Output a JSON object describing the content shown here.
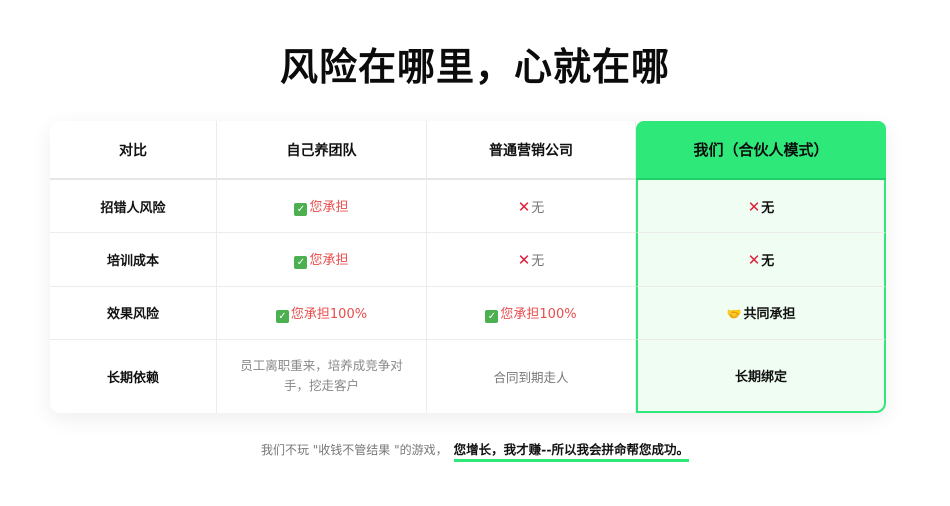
{
  "title": "风险在哪里，心就在哪",
  "table": {
    "headers": [
      "对比",
      "自己养团队",
      "普通营销公司",
      "我们（合伙人模式）"
    ],
    "rows": [
      {
        "label": "招错人风险",
        "self": {
          "icon": "check-icon",
          "text": "您承担"
        },
        "agency": {
          "icon": "cross-icon",
          "text": "无"
        },
        "ours": {
          "icon": "cross-icon",
          "text": "无"
        }
      },
      {
        "label": "培训成本",
        "self": {
          "icon": "check-icon",
          "text": "您承担"
        },
        "agency": {
          "icon": "cross-icon",
          "text": "无"
        },
        "ours": {
          "icon": "cross-icon",
          "text": "无"
        }
      },
      {
        "label": "效果风险",
        "self": {
          "icon": "check-icon",
          "text": "您承担100%"
        },
        "agency": {
          "icon": "check-icon",
          "text": "您承担100%"
        },
        "ours": {
          "icon": "handshake-icon",
          "text": "共同承担"
        }
      },
      {
        "label": "长期依赖",
        "self": {
          "text": "员工离职重来，培养成竞争对手，挖走客户"
        },
        "agency": {
          "text": "合同到期走人"
        },
        "ours": {
          "text": "长期绑定"
        }
      }
    ]
  },
  "footer": {
    "normal": "我们不玩 \"收钱不管结果 \"的游戏，",
    "highlight": "您增长，我才赚--所以我会拼命帮您成功。"
  },
  "colors": {
    "accent": "#2ee87a",
    "accent_bg": "#effdf3",
    "warn_text": "#e84c4c",
    "cross": "#e0203a",
    "check_bg": "#4caf50"
  }
}
